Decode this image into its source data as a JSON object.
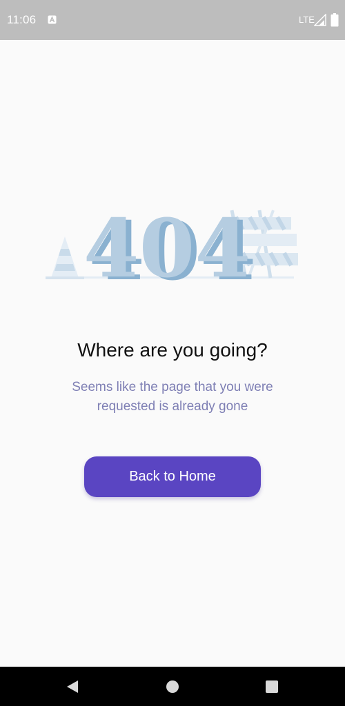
{
  "status_bar": {
    "time": "11:06",
    "network": "LTE",
    "notification_icon": "app-notification-icon",
    "signal_icon": "signal-icon",
    "battery_icon": "battery-icon"
  },
  "illustration": {
    "text": "404",
    "icons": [
      "traffic-cone-icon",
      "road-barrier-icon"
    ],
    "colors": {
      "digit_face": "#b5cde1",
      "digit_shadow": "#8ab1d0",
      "stripe": "#dbe7f1"
    }
  },
  "main": {
    "heading": "Where are you going?",
    "message_line1": "Seems like the page that you were",
    "message_line2": "requested is already gone",
    "button_label": "Back to Home"
  },
  "nav_bar": {
    "icons": [
      "back-icon",
      "home-icon",
      "recent-apps-icon"
    ]
  },
  "colors": {
    "accent": "#5a45c2",
    "message_text": "#7e7fb4",
    "status_bar": "#bdbdbd",
    "background": "#fafafa"
  }
}
